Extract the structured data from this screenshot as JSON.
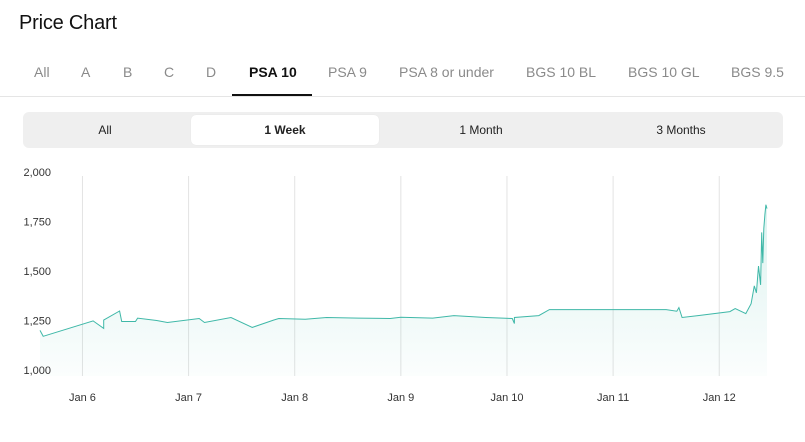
{
  "page_title": "Price Chart",
  "grade_tabs": [
    "All",
    "A",
    "B",
    "C",
    "D",
    "PSA 10",
    "PSA 9",
    "PSA 8 or under",
    "BGS 10 BL",
    "BGS 10 GL",
    "BGS 9.5"
  ],
  "active_grade_tab": "PSA 10",
  "range_tabs": [
    "All",
    "1 Week",
    "1 Month",
    "3 Months"
  ],
  "active_range_tab": "1 Week",
  "colors": {
    "line": "#3fb8a8",
    "fill": "#dff2ef",
    "grid": "#e3e3e3",
    "active_text": "#111111",
    "inactive_text": "#8a8a8a"
  },
  "chart_data": {
    "type": "area",
    "title": "",
    "xlabel": "",
    "ylabel": "",
    "ylim": [
      1000,
      2000
    ],
    "yticks": [
      "1,000",
      "1,250",
      "1,500",
      "1,750",
      "2,000"
    ],
    "ytick_values": [
      1000,
      1250,
      1500,
      1750,
      2000
    ],
    "xticks": [
      "Jan 6",
      "Jan 7",
      "Jan 8",
      "Jan 9",
      "Jan 10",
      "Jan 11",
      "Jan 12"
    ],
    "xtick_values": [
      6,
      7,
      8,
      9,
      10,
      11,
      12
    ],
    "xlim": [
      5.6,
      12.45
    ],
    "grid": "vertical",
    "series": [
      {
        "x": [
          5.6,
          5.63,
          6.1,
          6.2,
          6.2,
          6.35,
          6.37,
          6.5,
          6.52,
          6.7,
          6.8,
          7.1,
          7.15,
          7.4,
          7.6,
          7.8,
          7.85,
          8.1,
          8.3,
          8.6,
          8.9,
          9.0,
          9.3,
          9.5,
          9.8,
          10.05,
          10.07,
          10.07,
          10.3,
          10.4,
          10.8,
          11.2,
          11.5,
          11.6,
          11.62,
          11.65,
          11.8,
          12.1,
          12.15,
          12.25,
          12.3,
          12.33,
          12.35,
          12.37,
          12.39,
          12.4,
          12.41,
          12.42,
          12.43,
          12.44,
          12.45
        ],
        "y": [
          1200,
          1170,
          1248,
          1210,
          1252,
          1298,
          1245,
          1245,
          1262,
          1250,
          1240,
          1260,
          1240,
          1265,
          1215,
          1252,
          1260,
          1256,
          1265,
          1262,
          1260,
          1266,
          1262,
          1275,
          1265,
          1260,
          1235,
          1265,
          1275,
          1305,
          1305,
          1305,
          1305,
          1297,
          1315,
          1265,
          1275,
          1295,
          1310,
          1285,
          1335,
          1425,
          1390,
          1525,
          1430,
          1695,
          1540,
          1715,
          1785,
          1835,
          1815
        ]
      }
    ]
  }
}
